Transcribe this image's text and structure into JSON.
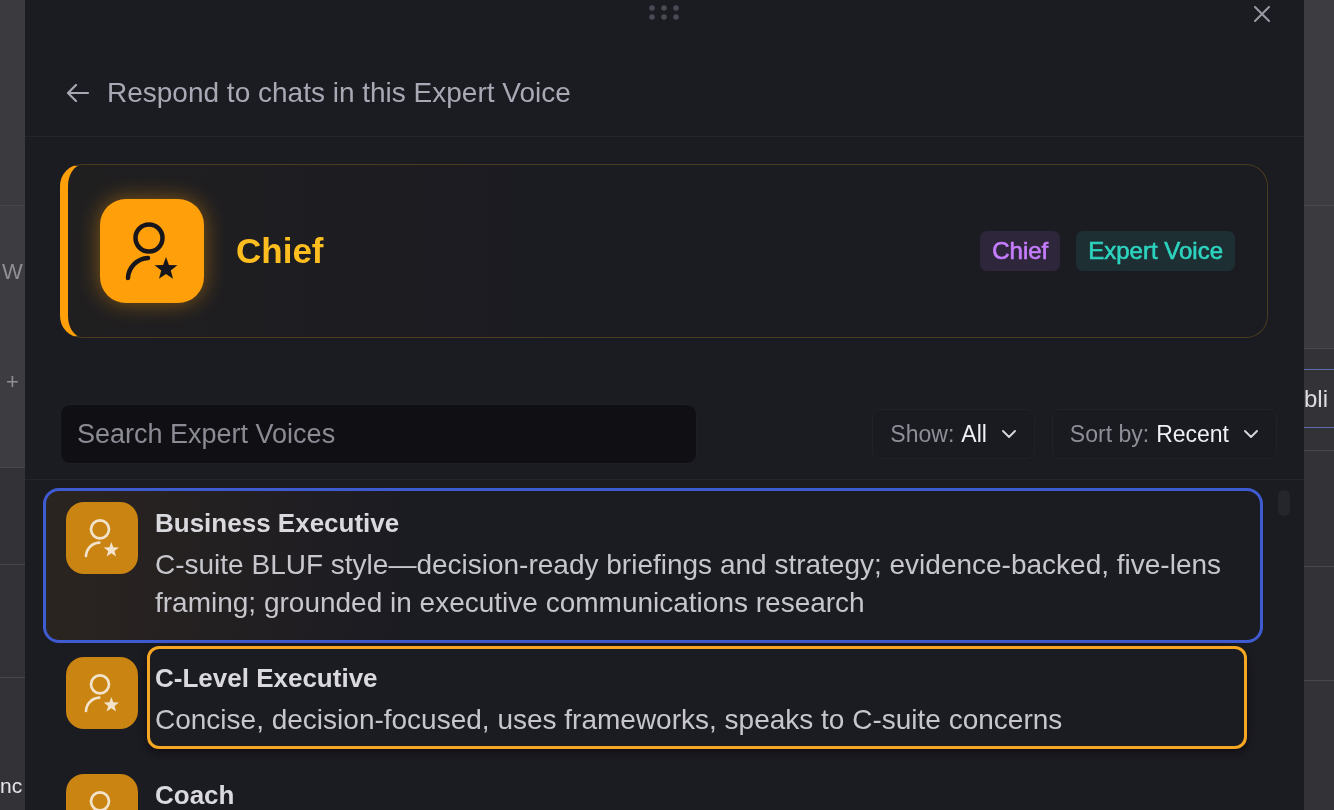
{
  "background": {
    "left_texts": [
      "W",
      "+"
    ],
    "left_bottom_text": "nc",
    "right_text": "bli"
  },
  "dialog": {
    "title": "Respond to chats in this Expert Voice",
    "current_voice": {
      "name": "Chief",
      "tags": [
        {
          "label": "Chief",
          "color": "#c77dff"
        },
        {
          "label": "Expert Voice",
          "color": "#2dd4bf"
        }
      ]
    },
    "search": {
      "placeholder": "Search Expert Voices"
    },
    "filters": [
      {
        "label": "Show:",
        "value": "All"
      },
      {
        "label": "Sort by:",
        "value": "Recent"
      }
    ],
    "voices": [
      {
        "name": "Business Executive",
        "description": "C-suite BLUF style—decision-ready briefings and strategy; evidence-backed, five-lens framing; grounded in executive communications research",
        "selected": true,
        "focused": false
      },
      {
        "name": "C-Level Executive",
        "description": "Concise, decision-focused, uses frameworks, speaks to C-suite concerns",
        "selected": false,
        "focused": true
      },
      {
        "name": "Coach",
        "selected": false,
        "focused": false
      }
    ]
  }
}
